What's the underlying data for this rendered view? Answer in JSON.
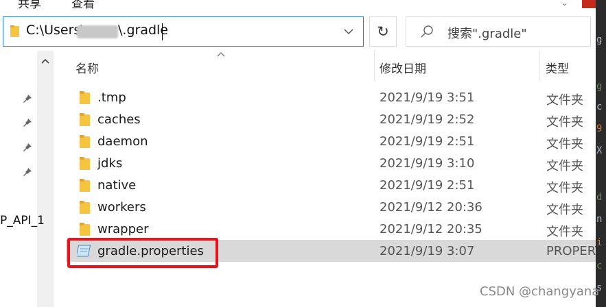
{
  "ribbon": {
    "tabs": [
      "共享",
      "查看"
    ]
  },
  "address": {
    "path_prefix": "C:\\Users\\",
    "path_suffix": "\\.gradle"
  },
  "search": {
    "placeholder": "搜索\".gradle\""
  },
  "nav": {
    "visible_label": "P_API_1"
  },
  "columns": {
    "name": "名称",
    "date": "修改日期",
    "type": "类型"
  },
  "files": [
    {
      "name": ".tmp",
      "date": "2021/9/19 3:51",
      "type": "文件夹",
      "icon": "folder-icon",
      "selected": false
    },
    {
      "name": "caches",
      "date": "2021/9/19 2:52",
      "type": "文件夹",
      "icon": "folder-icon",
      "selected": false
    },
    {
      "name": "daemon",
      "date": "2021/9/19 2:51",
      "type": "文件夹",
      "icon": "folder-icon",
      "selected": false
    },
    {
      "name": "jdks",
      "date": "2021/9/19 3:10",
      "type": "文件夹",
      "icon": "folder-icon",
      "selected": false
    },
    {
      "name": "native",
      "date": "2021/9/19 2:51",
      "type": "文件夹",
      "icon": "folder-icon",
      "selected": false
    },
    {
      "name": "workers",
      "date": "2021/9/12 20:36",
      "type": "文件夹",
      "icon": "folder-icon",
      "selected": false
    },
    {
      "name": "wrapper",
      "date": "2021/9/12 20:35",
      "type": "文件夹",
      "icon": "folder-icon",
      "selected": false
    },
    {
      "name": "gradle.properties",
      "date": "2021/9/19 3:07",
      "type": "PROPERT",
      "icon": "properties-file-icon",
      "selected": true
    }
  ],
  "watermark": "CSDN @changyana",
  "colors": {
    "highlight_border": "#e8141c",
    "selection": "#d9d9d9",
    "accent": "#2a7bd8",
    "folder": "#f5c542"
  }
}
